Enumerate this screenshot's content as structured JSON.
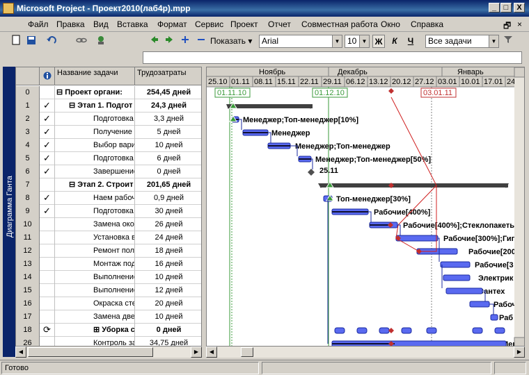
{
  "window": {
    "title": "Microsoft Project - Проект2010(лаб4р).mpp",
    "minimize": "_",
    "maximize": "□",
    "close": "X"
  },
  "menu": [
    "Файл",
    "Правка",
    "Вид",
    "Вставка",
    "Формат",
    "Сервис",
    "Проект",
    "Отчет",
    "Совместная работа",
    "Окно",
    "Справка"
  ],
  "doc_controls": {
    "restore": "🗗",
    "close": "×"
  },
  "toolbar": {
    "show_label": "Показать",
    "font": "Arial",
    "size": "10",
    "bold": "Ж",
    "italic": "К",
    "underline": "Ч",
    "filter": "Все задачи"
  },
  "sidebar_label": "Диаграмма Ганта",
  "grid": {
    "col_name": "Название задачи",
    "col_work": "Трудозатраты",
    "rows": [
      {
        "id": "0",
        "ind": "",
        "name": "⊟ Проект органи:",
        "work": "254,45 дней",
        "bold": true,
        "indent": 0
      },
      {
        "id": "1",
        "ind": "✓",
        "name": "⊟ Этап 1. Подгот",
        "work": "24,3 дней",
        "bold": true,
        "indent": 1
      },
      {
        "id": "2",
        "ind": "✓",
        "name": "Подготовка",
        "work": "3,3 дней",
        "bold": false,
        "indent": 2
      },
      {
        "id": "3",
        "ind": "✓",
        "name": "Получение р",
        "work": "5 дней",
        "bold": false,
        "indent": 2
      },
      {
        "id": "4",
        "ind": "✓",
        "name": "Выбор вари",
        "work": "10 дней",
        "bold": false,
        "indent": 2
      },
      {
        "id": "5",
        "ind": "✓",
        "name": "Подготовка",
        "work": "6 дней",
        "bold": false,
        "indent": 2
      },
      {
        "id": "6",
        "ind": "✓",
        "name": "Завершение",
        "work": "0 дней",
        "bold": false,
        "indent": 2
      },
      {
        "id": "7",
        "ind": "",
        "name": "⊟ Этап 2. Строит",
        "work": "201,65 дней",
        "bold": true,
        "indent": 1
      },
      {
        "id": "8",
        "ind": "✓",
        "name": "Наем рабоч",
        "work": "0,9 дней",
        "bold": false,
        "indent": 2
      },
      {
        "id": "9",
        "ind": "✓",
        "name": "Подготовка",
        "work": "30 дней",
        "bold": false,
        "indent": 2
      },
      {
        "id": "10",
        "ind": "",
        "name": "Замена око",
        "work": "26 дней",
        "bold": false,
        "indent": 2
      },
      {
        "id": "11",
        "ind": "",
        "name": "Установка в",
        "work": "24 дней",
        "bold": false,
        "indent": 2
      },
      {
        "id": "12",
        "ind": "",
        "name": "Ремонт пол",
        "work": "18 дней",
        "bold": false,
        "indent": 2
      },
      {
        "id": "13",
        "ind": "",
        "name": "Монтаж под",
        "work": "16 дней",
        "bold": false,
        "indent": 2
      },
      {
        "id": "14",
        "ind": "",
        "name": "Выполнение",
        "work": "10 дней",
        "bold": false,
        "indent": 2
      },
      {
        "id": "15",
        "ind": "",
        "name": "Выполнение",
        "work": "12 дней",
        "bold": false,
        "indent": 2
      },
      {
        "id": "16",
        "ind": "",
        "name": "Окраска сте",
        "work": "20 дней",
        "bold": false,
        "indent": 2
      },
      {
        "id": "17",
        "ind": "",
        "name": "Замена две",
        "work": "10 дней",
        "bold": false,
        "indent": 2
      },
      {
        "id": "18",
        "ind": "⟳",
        "name": "⊞ Уборка стр",
        "work": "0 дней",
        "bold": true,
        "indent": 2
      },
      {
        "id": "26",
        "ind": "",
        "name": "Контроль за",
        "work": "34,75 дней",
        "bold": false,
        "indent": 2
      }
    ]
  },
  "timescale": {
    "months": [
      "Ноябрь",
      "Декабрь",
      "Январь"
    ],
    "weeks": [
      "25.10",
      "01.11",
      "08.11",
      "15.11",
      "22.11",
      "29.11",
      "06.12",
      "13.12",
      "20.12",
      "27.12",
      "03.01",
      "10.01",
      "17.01",
      "24"
    ]
  },
  "markers": [
    "01.11.10",
    "01.12.10",
    "03.01.11"
  ],
  "milestone_label": "25.11",
  "bar_labels": [
    "Менеджер;Топ-менеджер[10%]",
    "Менеджер",
    "Менеджер;Топ-менеджер",
    "Менеджер;Топ-менеджер[50%]",
    "Топ-менеджер[30%]",
    "Рабочие[400%]",
    "Рабочие[400%];Стеклопакеты",
    "Рабочие[300%];Гип",
    "Рабочие[200",
    "Рабочие[3",
    "Электрик",
    "Сантех",
    "Рабоч",
    "Раб",
    "Мен"
  ],
  "status": "Готово"
}
